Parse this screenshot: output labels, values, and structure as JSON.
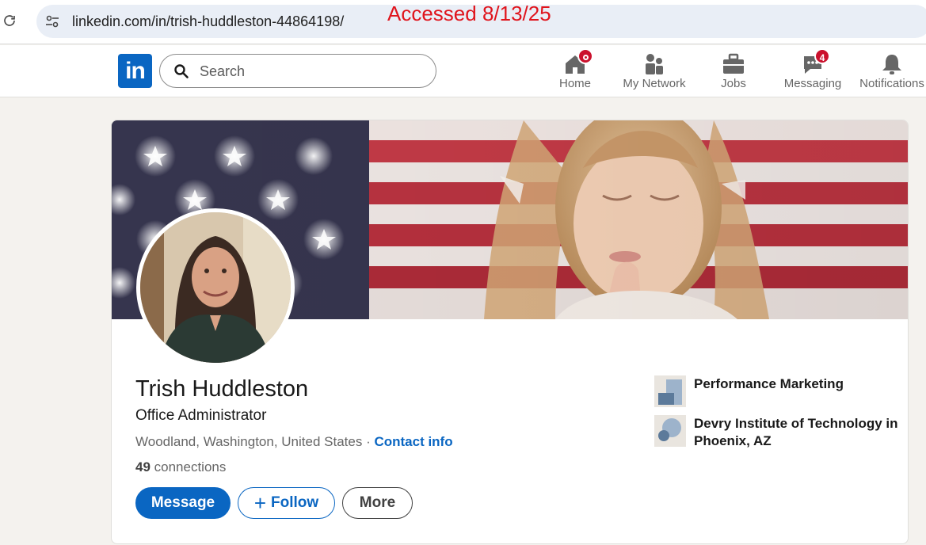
{
  "browser": {
    "url": "linkedin.com/in/trish-huddleston-44864198/",
    "annotation": "Accessed 8/13/25"
  },
  "nav": {
    "logo_text": "in",
    "search_placeholder": "Search",
    "items": [
      {
        "label": "Home",
        "icon": "home-icon",
        "badge": ""
      },
      {
        "label": "My Network",
        "icon": "people-icon",
        "badge": ""
      },
      {
        "label": "Jobs",
        "icon": "briefcase-icon",
        "badge": ""
      },
      {
        "label": "Messaging",
        "icon": "chat-icon",
        "badge": "4"
      },
      {
        "label": "Notifications",
        "icon": "bell-icon",
        "badge": ""
      }
    ]
  },
  "profile": {
    "name": "Trish Huddleston",
    "headline": "Office Administrator",
    "location": "Woodland, Washington, United States",
    "separator": " · ",
    "contact_label": "Contact info",
    "connections_count": "49",
    "connections_label": " connections",
    "buttons": {
      "message": "Message",
      "follow": "Follow",
      "follow_icon": "+",
      "more": "More"
    },
    "experience": [
      {
        "name": "Performance Marketing",
        "icon": "company-logo-icon"
      },
      {
        "name": "Devry Institute of Technology in Phoenix, AZ",
        "icon": "school-logo-icon"
      }
    ]
  },
  "colors": {
    "brand_blue": "#0a66c2",
    "badge_red": "#cb112d",
    "annotation_red": "#e0141c"
  }
}
